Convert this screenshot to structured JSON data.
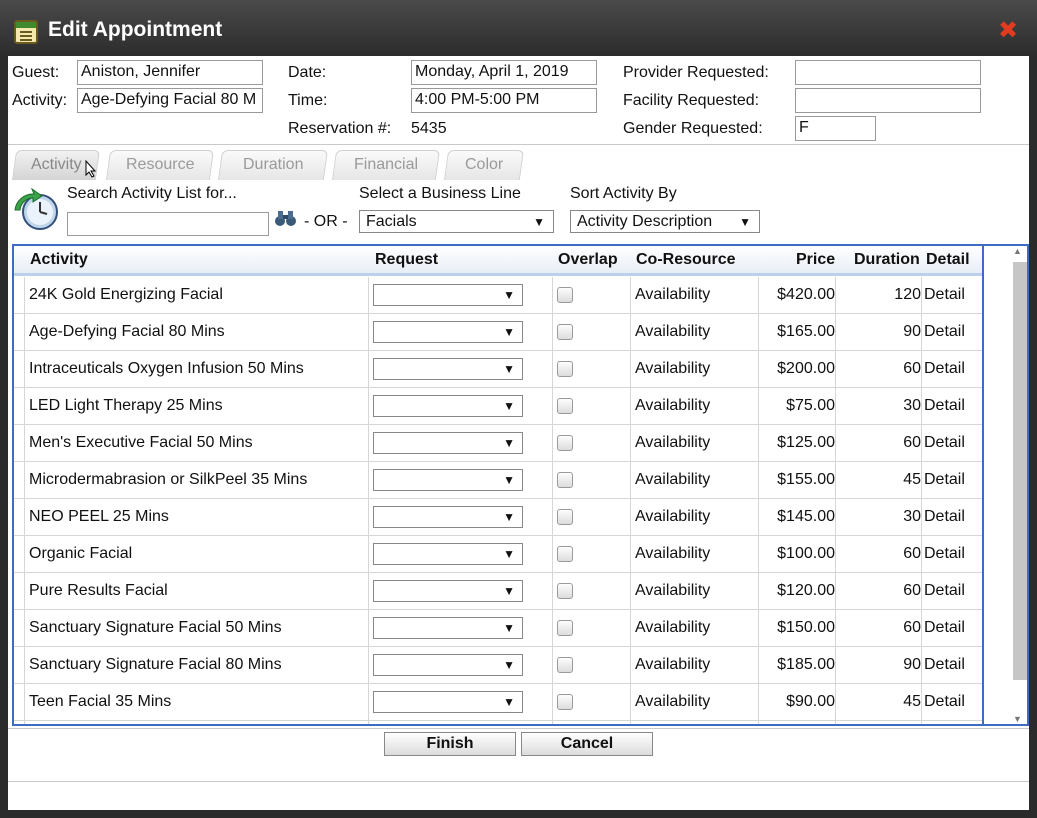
{
  "window": {
    "title": "Edit Appointment"
  },
  "header": {
    "guest_label": "Guest:",
    "guest": "Aniston, Jennifer",
    "activity_label": "Activity:",
    "activity": "Age-Defying Facial 80 M",
    "date_label": "Date:",
    "date": "Monday, April 1, 2019",
    "time_label": "Time:",
    "time": "4:00 PM-5:00 PM",
    "reservation_label": "Reservation #:",
    "reservation": "5435",
    "provider_label": "Provider Requested:",
    "provider": "",
    "facility_label": "Facility Requested:",
    "facility": "",
    "gender_label": "Gender Requested:",
    "gender": "F"
  },
  "tabs": [
    "Activity",
    "Resource",
    "Duration",
    "Financial",
    "Color"
  ],
  "search": {
    "label": "Search Activity List for...",
    "or": "- OR -",
    "business_line_label": "Select a Business Line",
    "business_line": "Facials",
    "sort_label": "Sort Activity By",
    "sort": "Activity Description"
  },
  "table": {
    "headers": [
      "Activity",
      "Request",
      "Overlap",
      "Co-Resource",
      "Price",
      "Duration",
      "Detail"
    ],
    "rows": [
      [
        "24K Gold Energizing Facial",
        "Availability",
        "$420.00",
        "120",
        "Detail"
      ],
      [
        "Age-Defying Facial 80 Mins",
        "Availability",
        "$165.00",
        "90",
        "Detail"
      ],
      [
        "Intraceuticals Oxygen Infusion 50 Mins",
        "Availability",
        "$200.00",
        "60",
        "Detail"
      ],
      [
        "LED Light Therapy 25 Mins",
        "Availability",
        "$75.00",
        "30",
        "Detail"
      ],
      [
        "Men's Executive Facial 50 Mins",
        "Availability",
        "$125.00",
        "60",
        "Detail"
      ],
      [
        "Microdermabrasion or SilkPeel 35 Mins",
        "Availability",
        "$155.00",
        "45",
        "Detail"
      ],
      [
        "NEO PEEL 25 Mins",
        "Availability",
        "$145.00",
        "30",
        "Detail"
      ],
      [
        "Organic Facial",
        "Availability",
        "$100.00",
        "60",
        "Detail"
      ],
      [
        "Pure Results Facial",
        "Availability",
        "$120.00",
        "60",
        "Detail"
      ],
      [
        "Sanctuary Signature Facial 50 Mins",
        "Availability",
        "$150.00",
        "60",
        "Detail"
      ],
      [
        "Sanctuary Signature Facial 80 Mins",
        "Availability",
        "$185.00",
        "90",
        "Detail"
      ],
      [
        "Teen Facial 35 Mins",
        "Availability",
        "$90.00",
        "45",
        "Detail"
      ]
    ]
  },
  "buttons": {
    "finish": "Finish",
    "cancel": "Cancel"
  }
}
